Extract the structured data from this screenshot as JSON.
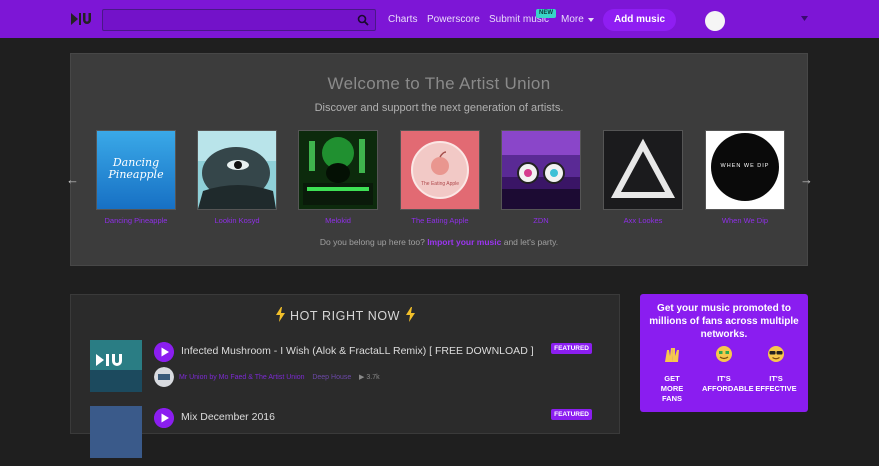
{
  "nav": {
    "search_placeholder": "",
    "links": [
      "Charts",
      "Powerscore",
      "Submit music",
      "More"
    ],
    "new_badge": "NEW",
    "add_music": "Add music",
    "colors": {
      "bar": "#7d16d6",
      "accent": "#8b1ef0",
      "badge": "#38d5c8"
    }
  },
  "welcome": {
    "title": "Welcome to The Artist Union",
    "subtitle": "Discover and support the next generation of artists.",
    "artists": [
      {
        "name": "Dancing Pineapple",
        "cover_text": "Dancing Pineapple"
      },
      {
        "name": "Lookin Kosyd",
        "cover_text": ""
      },
      {
        "name": "Melokid",
        "cover_text": ""
      },
      {
        "name": "The Eating Apple",
        "cover_text": "The Eating Apple"
      },
      {
        "name": "ZDN",
        "cover_text": ""
      },
      {
        "name": "Axx Lookes",
        "cover_text": ""
      },
      {
        "name": "When We Dip",
        "cover_text": "WHEN WE DIP"
      }
    ],
    "footer_prefix": "Do you belong up here too?",
    "footer_link": "Import your music",
    "footer_suffix": "and let's party."
  },
  "hot": {
    "title": "HOT RIGHT NOW",
    "tracks": [
      {
        "title": "Infected Mushroom - I Wish (Alok & FractaLL Remix) [ FREE DOWNLOAD ]",
        "uploader": "Mr Union by Mo Faed & The Artist Union",
        "genre": "Deep House",
        "plays": "3.7k",
        "badge": "FEATURED"
      },
      {
        "title": "Mix December 2016",
        "uploader": "",
        "genre": "",
        "plays": "",
        "badge": "FEATURED"
      }
    ]
  },
  "promo": {
    "headline": "Get your music promoted to millions of fans across multiple networks.",
    "features": [
      {
        "icon": "raised-hands-icon",
        "label_line1": "GET",
        "label_line2": "MORE",
        "label_line3": "FANS"
      },
      {
        "icon": "money-face-icon",
        "label_line1": "IT'S",
        "label_line2": "AFFORDABLE",
        "label_line3": ""
      },
      {
        "icon": "sunglasses-face-icon",
        "label_line1": "IT'S",
        "label_line2": "EFFECTIVE",
        "label_line3": ""
      }
    ]
  }
}
